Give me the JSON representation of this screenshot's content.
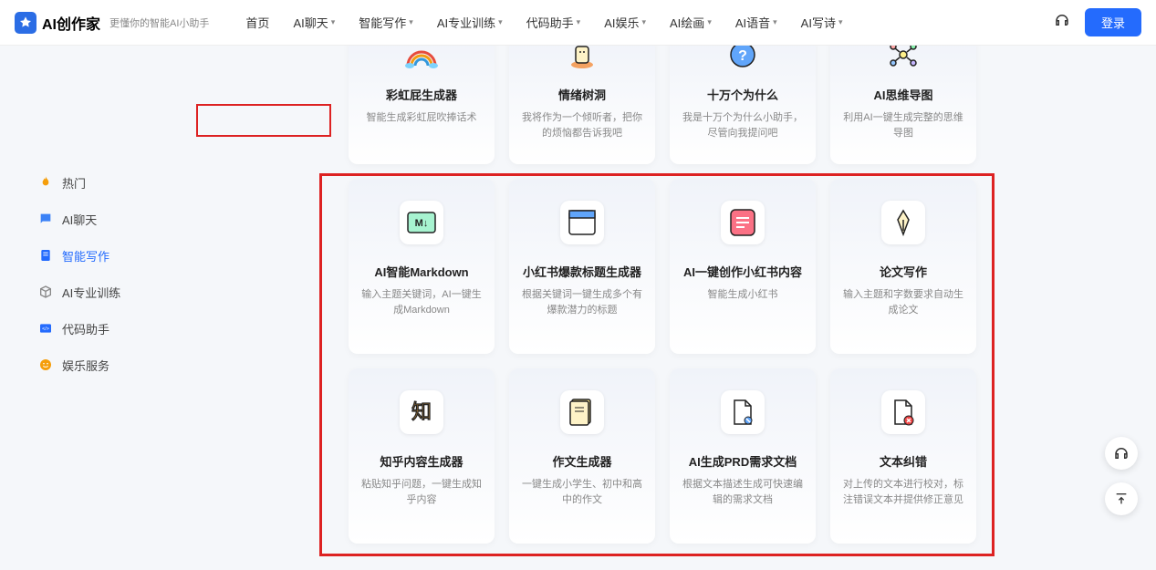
{
  "header": {
    "logo_text": "AI创作家",
    "tagline": "更懂你的智能AI小助手",
    "nav": [
      "首页",
      "AI聊天",
      "智能写作",
      "AI专业训练",
      "代码助手",
      "AI娱乐",
      "AI绘画",
      "AI语音",
      "AI写诗"
    ],
    "login": "登录"
  },
  "sidebar": {
    "items": [
      {
        "label": "热门",
        "icon": "fire",
        "color": "#f59e0b"
      },
      {
        "label": "AI聊天",
        "icon": "chat",
        "color": "#3b82f6"
      },
      {
        "label": "智能写作",
        "icon": "doc",
        "color": "#246bfd"
      },
      {
        "label": "AI专业训练",
        "icon": "cube",
        "color": "#888"
      },
      {
        "label": "代码助手",
        "icon": "code",
        "color": "#246bfd"
      },
      {
        "label": "娱乐服务",
        "icon": "smile",
        "color": "#f59e0b"
      }
    ]
  },
  "cards_top": [
    {
      "title": "彩虹屁生成器",
      "desc": "智能生成彩虹屁吹捧话术"
    },
    {
      "title": "情绪树洞",
      "desc": "我将作为一个倾听者，把你的烦恼都告诉我吧"
    },
    {
      "title": "十万个为什么",
      "desc": "我是十万个为什么小助手，尽管向我提问吧"
    },
    {
      "title": "AI思维导图",
      "desc": "利用AI一键生成完整的思维导图"
    }
  ],
  "cards_mid": [
    {
      "title": "AI智能Markdown",
      "desc": "输入主题关键词，AI一键生成Markdown"
    },
    {
      "title": "小红书爆款标题生成器",
      "desc": "根据关键词一键生成多个有爆款潜力的标题"
    },
    {
      "title": "AI一键创作小红书内容",
      "desc": "智能生成小红书"
    },
    {
      "title": "论文写作",
      "desc": "输入主题和字数要求自动生成论文"
    }
  ],
  "cards_bot": [
    {
      "title": "知乎内容生成器",
      "desc": "粘贴知乎问题，一键生成知乎内容"
    },
    {
      "title": "作文生成器",
      "desc": "一键生成小学生、初中和高中的作文"
    },
    {
      "title": "AI生成PRD需求文档",
      "desc": "根据文本描述生成可快速编辑的需求文档"
    },
    {
      "title": "文本纠错",
      "desc": "对上传的文本进行校对，标注错误文本并提供修正意见"
    }
  ]
}
